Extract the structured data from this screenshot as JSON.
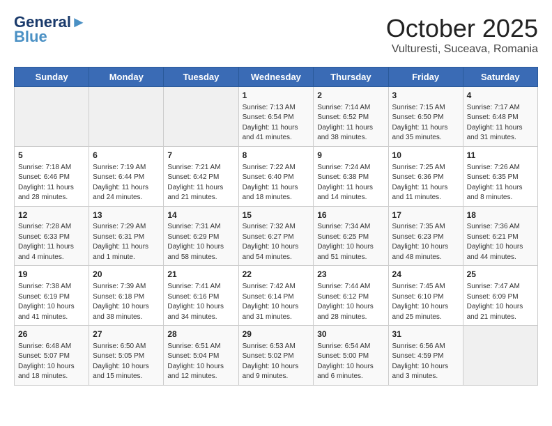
{
  "header": {
    "logo_line1": "General",
    "logo_line2": "Blue",
    "month": "October 2025",
    "location": "Vulturesti, Suceava, Romania"
  },
  "weekdays": [
    "Sunday",
    "Monday",
    "Tuesday",
    "Wednesday",
    "Thursday",
    "Friday",
    "Saturday"
  ],
  "weeks": [
    [
      {
        "day": "",
        "info": ""
      },
      {
        "day": "",
        "info": ""
      },
      {
        "day": "",
        "info": ""
      },
      {
        "day": "1",
        "info": "Sunrise: 7:13 AM\nSunset: 6:54 PM\nDaylight: 11 hours and 41 minutes."
      },
      {
        "day": "2",
        "info": "Sunrise: 7:14 AM\nSunset: 6:52 PM\nDaylight: 11 hours and 38 minutes."
      },
      {
        "day": "3",
        "info": "Sunrise: 7:15 AM\nSunset: 6:50 PM\nDaylight: 11 hours and 35 minutes."
      },
      {
        "day": "4",
        "info": "Sunrise: 7:17 AM\nSunset: 6:48 PM\nDaylight: 11 hours and 31 minutes."
      }
    ],
    [
      {
        "day": "5",
        "info": "Sunrise: 7:18 AM\nSunset: 6:46 PM\nDaylight: 11 hours and 28 minutes."
      },
      {
        "day": "6",
        "info": "Sunrise: 7:19 AM\nSunset: 6:44 PM\nDaylight: 11 hours and 24 minutes."
      },
      {
        "day": "7",
        "info": "Sunrise: 7:21 AM\nSunset: 6:42 PM\nDaylight: 11 hours and 21 minutes."
      },
      {
        "day": "8",
        "info": "Sunrise: 7:22 AM\nSunset: 6:40 PM\nDaylight: 11 hours and 18 minutes."
      },
      {
        "day": "9",
        "info": "Sunrise: 7:24 AM\nSunset: 6:38 PM\nDaylight: 11 hours and 14 minutes."
      },
      {
        "day": "10",
        "info": "Sunrise: 7:25 AM\nSunset: 6:36 PM\nDaylight: 11 hours and 11 minutes."
      },
      {
        "day": "11",
        "info": "Sunrise: 7:26 AM\nSunset: 6:35 PM\nDaylight: 11 hours and 8 minutes."
      }
    ],
    [
      {
        "day": "12",
        "info": "Sunrise: 7:28 AM\nSunset: 6:33 PM\nDaylight: 11 hours and 4 minutes."
      },
      {
        "day": "13",
        "info": "Sunrise: 7:29 AM\nSunset: 6:31 PM\nDaylight: 11 hours and 1 minute."
      },
      {
        "day": "14",
        "info": "Sunrise: 7:31 AM\nSunset: 6:29 PM\nDaylight: 10 hours and 58 minutes."
      },
      {
        "day": "15",
        "info": "Sunrise: 7:32 AM\nSunset: 6:27 PM\nDaylight: 10 hours and 54 minutes."
      },
      {
        "day": "16",
        "info": "Sunrise: 7:34 AM\nSunset: 6:25 PM\nDaylight: 10 hours and 51 minutes."
      },
      {
        "day": "17",
        "info": "Sunrise: 7:35 AM\nSunset: 6:23 PM\nDaylight: 10 hours and 48 minutes."
      },
      {
        "day": "18",
        "info": "Sunrise: 7:36 AM\nSunset: 6:21 PM\nDaylight: 10 hours and 44 minutes."
      }
    ],
    [
      {
        "day": "19",
        "info": "Sunrise: 7:38 AM\nSunset: 6:19 PM\nDaylight: 10 hours and 41 minutes."
      },
      {
        "day": "20",
        "info": "Sunrise: 7:39 AM\nSunset: 6:18 PM\nDaylight: 10 hours and 38 minutes."
      },
      {
        "day": "21",
        "info": "Sunrise: 7:41 AM\nSunset: 6:16 PM\nDaylight: 10 hours and 34 minutes."
      },
      {
        "day": "22",
        "info": "Sunrise: 7:42 AM\nSunset: 6:14 PM\nDaylight: 10 hours and 31 minutes."
      },
      {
        "day": "23",
        "info": "Sunrise: 7:44 AM\nSunset: 6:12 PM\nDaylight: 10 hours and 28 minutes."
      },
      {
        "day": "24",
        "info": "Sunrise: 7:45 AM\nSunset: 6:10 PM\nDaylight: 10 hours and 25 minutes."
      },
      {
        "day": "25",
        "info": "Sunrise: 7:47 AM\nSunset: 6:09 PM\nDaylight: 10 hours and 21 minutes."
      }
    ],
    [
      {
        "day": "26",
        "info": "Sunrise: 6:48 AM\nSunset: 5:07 PM\nDaylight: 10 hours and 18 minutes."
      },
      {
        "day": "27",
        "info": "Sunrise: 6:50 AM\nSunset: 5:05 PM\nDaylight: 10 hours and 15 minutes."
      },
      {
        "day": "28",
        "info": "Sunrise: 6:51 AM\nSunset: 5:04 PM\nDaylight: 10 hours and 12 minutes."
      },
      {
        "day": "29",
        "info": "Sunrise: 6:53 AM\nSunset: 5:02 PM\nDaylight: 10 hours and 9 minutes."
      },
      {
        "day": "30",
        "info": "Sunrise: 6:54 AM\nSunset: 5:00 PM\nDaylight: 10 hours and 6 minutes."
      },
      {
        "day": "31",
        "info": "Sunrise: 6:56 AM\nSunset: 4:59 PM\nDaylight: 10 hours and 3 minutes."
      },
      {
        "day": "",
        "info": ""
      }
    ]
  ]
}
